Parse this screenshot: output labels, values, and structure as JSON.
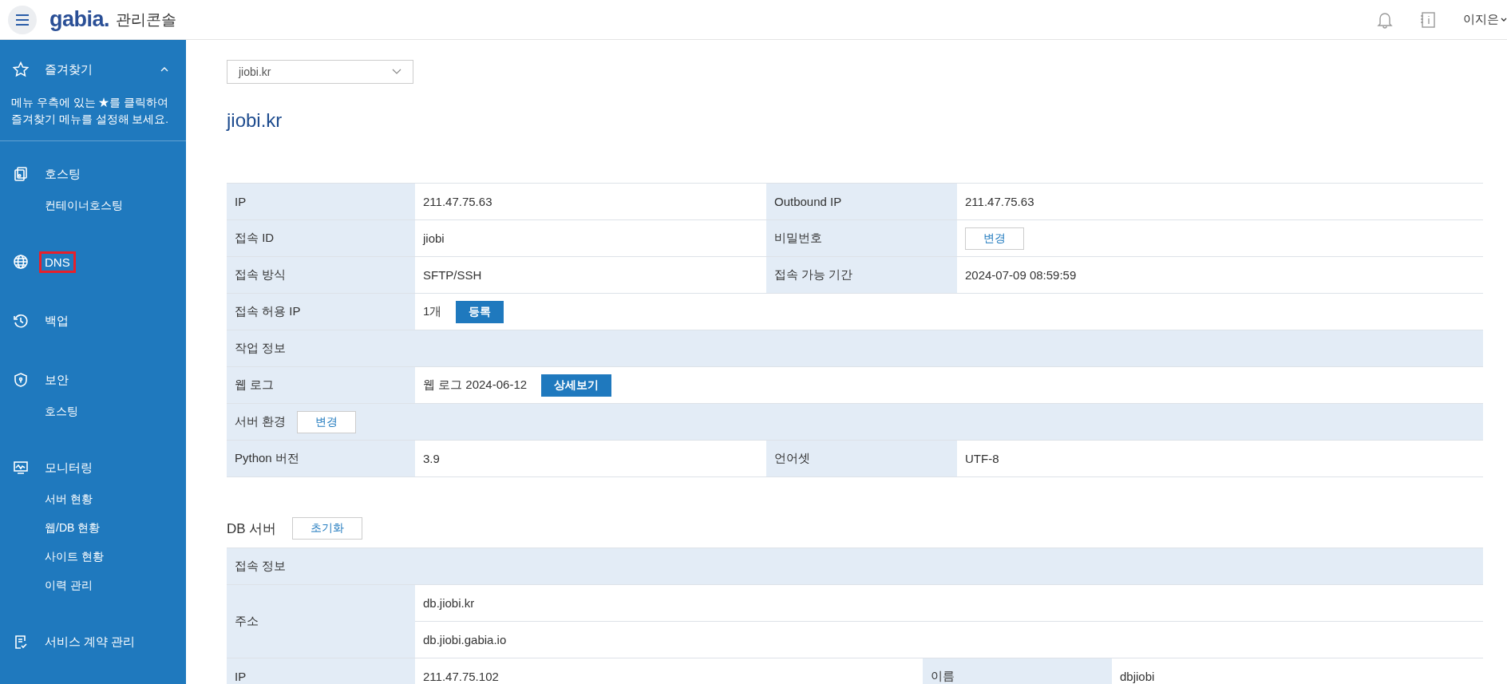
{
  "header": {
    "logo": "gabia.",
    "title": "관리콘솔",
    "user": "이지은"
  },
  "sidebar": {
    "favorites": {
      "label": "즐겨찾기",
      "expanded": true,
      "hint": "메뉴 우측에 있는 ★를 클릭하여 즐겨찾기 메뉴를 설정해 보세요."
    },
    "groups": [
      {
        "label": "호스팅",
        "selected": false,
        "children": [
          "컨테이너호스팅"
        ]
      },
      {
        "label": "DNS",
        "selected": true
      },
      {
        "label": "백업",
        "selected": false
      },
      {
        "label": "보안",
        "selected": false,
        "children": [
          "호스팅"
        ]
      },
      {
        "label": "모니터링",
        "selected": false,
        "children": [
          "서버 현황",
          "웹/DB 현황",
          "사이트 현황",
          "이력 관리"
        ]
      },
      {
        "label": "서비스 계약 관리",
        "selected": false
      }
    ]
  },
  "domain_select": {
    "value": "jiobi.kr"
  },
  "title": "jiobi.kr",
  "server_table": [
    {
      "kind": "pair",
      "label": "IP",
      "value": "211.47.75.63",
      "label2": "Outbound IP",
      "value2": "211.47.75.63"
    },
    {
      "kind": "pair",
      "label": "접속 ID",
      "value": "jiobi",
      "label2": "비밀번호",
      "button2": {
        "label": "변경"
      }
    },
    {
      "kind": "pair",
      "label": "접속 방식",
      "value": "SFTP/SSH",
      "label2": "접속 가능 기간",
      "value2": "2024-07-09 08:59:59"
    },
    {
      "kind": "single",
      "label": "접속 허용 IP",
      "value": "1개",
      "button": {
        "label": "등록"
      }
    },
    {
      "kind": "section",
      "label": "작업 정보"
    },
    {
      "kind": "single",
      "label": "웹 로그",
      "value": "웹 로그 2024-06-12",
      "button": {
        "label": "상세보기"
      }
    },
    {
      "kind": "section",
      "label": "서버 환경",
      "button": {
        "label": "변경"
      }
    },
    {
      "kind": "pair",
      "label": "Python 버전",
      "value": "3.9",
      "label2": "언어셋",
      "value2": "UTF-8"
    }
  ],
  "db": {
    "title": "DB 서버",
    "button": {
      "label": "초기화"
    },
    "rows": [
      {
        "kind": "section",
        "label": "접속 정보"
      },
      {
        "kind": "multi",
        "label": "주소",
        "values": [
          "db.jiobi.kr",
          "db.jiobi.gabia.io"
        ]
      },
      {
        "kind": "pair",
        "label": "IP",
        "value": "211.47.75.102",
        "label2": "이름",
        "value2": "dbjiobi"
      }
    ]
  }
}
